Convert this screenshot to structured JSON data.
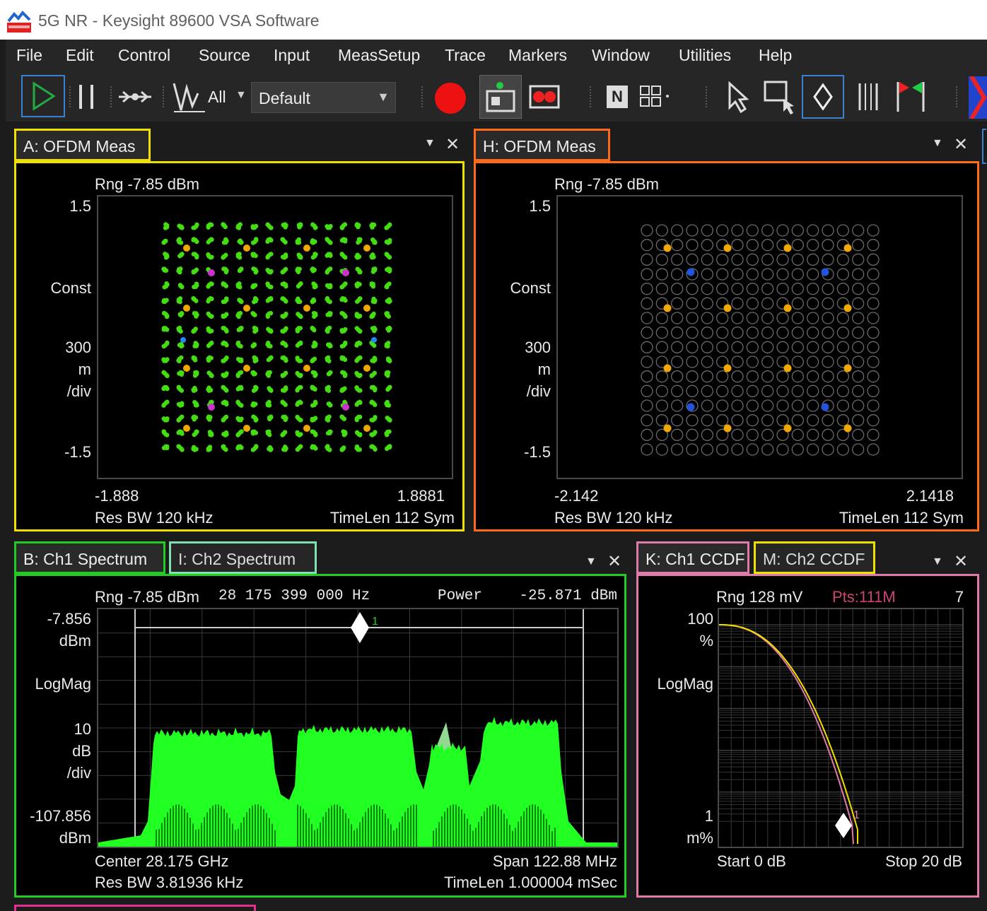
{
  "window": {
    "title": "5G NR - Keysight 89600 VSA Software"
  },
  "menu": [
    "File",
    "Edit",
    "Control",
    "Source",
    "Input",
    "MeasSetup",
    "Trace",
    "Markers",
    "Window",
    "Utilities",
    "Help"
  ],
  "toolbar": {
    "trace_select_label": "All",
    "preset_combo_value": "Default"
  },
  "panels": {
    "a": {
      "tab": "A: OFDM Meas",
      "range": "Rng -7.85 dBm",
      "y_top": "1.5",
      "format": "Const",
      "scale_value": "300",
      "scale_unit": "m",
      "scale_div": "/div",
      "y_bottom": "-1.5",
      "x_left": "-1.888",
      "x_right": "1.8881",
      "res_bw": "Res BW 120 kHz",
      "time_len": "TimeLen 112  Sym"
    },
    "h": {
      "tab": "H: OFDM Meas",
      "range": "Rng -7.85 dBm",
      "y_top": "1.5",
      "format": "Const",
      "scale_value": "300",
      "scale_unit": "m",
      "scale_div": "/div",
      "y_bottom": "-1.5",
      "x_left": "-2.142",
      "x_right": "2.1418",
      "res_bw": "Res BW 120 kHz",
      "time_len": "TimeLen 112  Sym"
    },
    "b": {
      "tab": "B: Ch1 Spectrum",
      "tab2": "I: Ch2 Spectrum",
      "header_left": "Rng -7.85 dBm",
      "header_freq": "28 175 399 000 Hz",
      "header_power_label": "Power",
      "header_power_value": "-25.871 dBm",
      "y_top_value": "-7.856",
      "y_top_unit": "dBm",
      "format": "LogMag",
      "scale_value": "10",
      "scale_unit": "dB",
      "scale_div": "/div",
      "y_bottom_value": "-107.856",
      "y_bottom_unit": "dBm",
      "center": "Center 28.175 GHz",
      "span": "Span 122.88 MHz",
      "res_bw": "Res BW 3.81936 kHz",
      "time_len": "TimeLen 1.000004 mSec",
      "marker_label": "1"
    },
    "k": {
      "tab": "K: Ch1 CCDF",
      "tab2": "M: Ch2 CCDF",
      "range": "Rng 128 mV",
      "points": "Pts:111M",
      "corner": "7",
      "y_top_value": "100",
      "y_top_unit": "%",
      "format": "LogMag",
      "y_bottom_value": "1",
      "y_bottom_unit": "m%",
      "start": "Start 0 dB",
      "stop": "Stop 20 dB",
      "marker_label": "1"
    }
  },
  "colors": {
    "panel_a": "#f0e000",
    "panel_h": "#ff6a1a",
    "panel_b": "#22cc22",
    "panel_i": "#7fe0b0",
    "panel_k": "#e07aa8",
    "panel_m": "#f0e000",
    "const_green": "#44dd11",
    "const_orange": "#f0a800",
    "spectrum_green": "#22ff22",
    "spectrum_light": "#aaffaa",
    "run_icon": "#22aa44",
    "record_icon": "#ee1111",
    "points_label": "#cc4477"
  }
}
